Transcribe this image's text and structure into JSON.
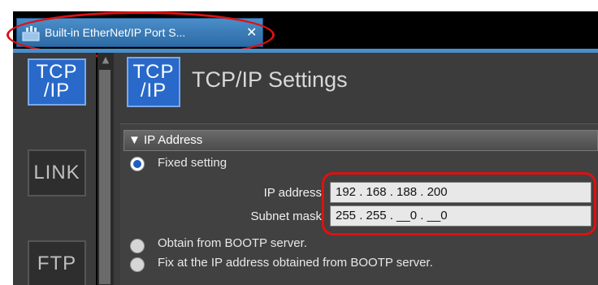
{
  "tab": {
    "title": "Built-in EtherNet/IP Port S...",
    "close": "✕",
    "icon": "ethernet-port-icon"
  },
  "sidebar": {
    "items": [
      {
        "label": "TCP\n/IP",
        "icon": "tcpip-icon",
        "active": true
      },
      {
        "label": "LINK",
        "icon": "link-icon",
        "active": false
      },
      {
        "label": "FTP",
        "icon": "ftp-icon",
        "active": false
      }
    ]
  },
  "header": {
    "icon_text": "TCP\n/IP",
    "title": "TCP/IP Settings"
  },
  "section": {
    "title": "▼ IP Address"
  },
  "options": {
    "fixed": "Fixed setting",
    "bootp": "Obtain from BOOTP server.",
    "fix_bootp": "Fix at the IP address obtained from BOOTP server."
  },
  "fields": {
    "ip_label": "IP address",
    "ip_value": "192 . 168 . 188 . 200",
    "subnet_label": "Subnet mask",
    "subnet_value": "255 . 255 . __0 . __0"
  },
  "colors": {
    "accent": "#2869c9",
    "highlight": "#e01010",
    "tab": "#4a8ec9"
  }
}
